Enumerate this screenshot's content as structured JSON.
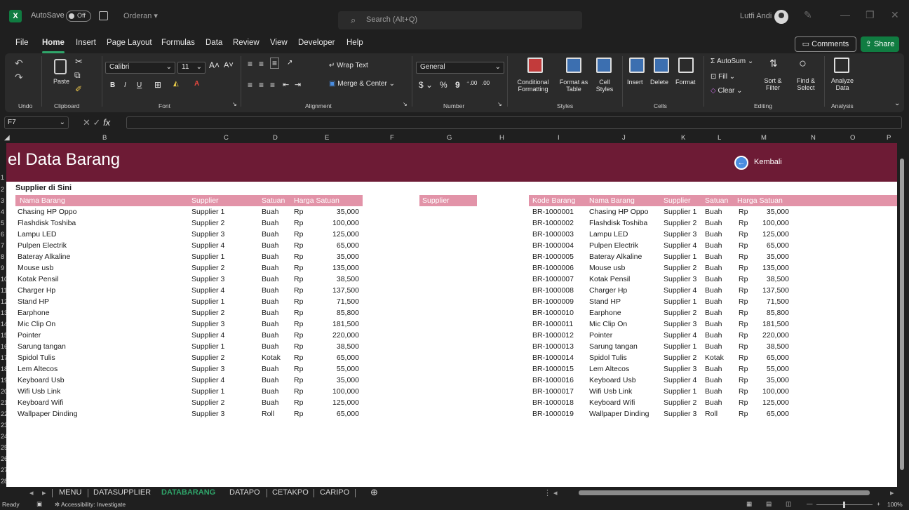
{
  "titlebar": {
    "app_icon": "X",
    "autosave_label": "AutoSave",
    "autosave_state": "Off",
    "document_name": "Orderan",
    "search_placeholder": "Search (Alt+Q)",
    "user_name": "Lutfi Andi"
  },
  "menu": {
    "tabs": [
      "File",
      "Home",
      "Insert",
      "Page Layout",
      "Formulas",
      "Data",
      "Review",
      "View",
      "Developer",
      "Help"
    ],
    "active": "Home",
    "comments_label": "Comments",
    "share_label": "Share"
  },
  "ribbon": {
    "groups": [
      "Undo",
      "Clipboard",
      "Font",
      "Alignment",
      "Number",
      "Styles",
      "Cells",
      "Editing",
      "Analysis"
    ],
    "paste_label": "Paste",
    "font_name": "Calibri",
    "font_size": "11",
    "wrap_text_label": "Wrap Text",
    "merge_center_label": "Merge & Center",
    "number_format": "General",
    "conditional_formatting_label": "Conditional Formatting",
    "format_as_table_label": "Format as Table",
    "cell_styles_label": "Cell Styles",
    "insert_label": "Insert",
    "delete_label": "Delete",
    "format_label": "Format",
    "autosum_label": "AutoSum",
    "fill_label": "Fill",
    "clear_label": "Clear",
    "sort_filter_label": "Sort & Filter",
    "find_select_label": "Find & Select",
    "analyze_data_label": "Analyze Data"
  },
  "formula_bar": {
    "name_box": "F7",
    "formula": ""
  },
  "columns": [
    "B",
    "C",
    "D",
    "E",
    "F",
    "G",
    "H",
    "I",
    "J",
    "K",
    "L",
    "M",
    "N",
    "O",
    "P"
  ],
  "rows": [
    "1",
    "2",
    "3",
    "4",
    "5",
    "6",
    "7",
    "8",
    "9",
    "10",
    "11",
    "12",
    "13",
    "14",
    "15",
    "16",
    "17",
    "18",
    "19",
    "20",
    "21",
    "22",
    "23",
    "24",
    "25",
    "26",
    "27",
    "28"
  ],
  "sheet": {
    "banner_title": "el Data Barang",
    "kembali_label": "Kembali",
    "supplier_prompt": "Supplier di Sini",
    "left_headers": [
      "Nama Barang",
      "Supplier",
      "Satuan",
      "Harga Satuan"
    ],
    "filter_header": "Supplier",
    "right_headers": [
      "Kode Barang",
      "Nama Barang",
      "Supplier",
      "Satuan",
      "Harga Satuan"
    ],
    "items": [
      {
        "kode": "BR-1000001",
        "nama": "Chasing HP Oppo",
        "supplier": "Supplier 1",
        "satuan": "Buah",
        "rp": "Rp",
        "harga": "35,000"
      },
      {
        "kode": "BR-1000002",
        "nama": "Flashdisk Toshiba",
        "supplier": "Supplier 2",
        "satuan": "Buah",
        "rp": "Rp",
        "harga": "100,000"
      },
      {
        "kode": "BR-1000003",
        "nama": "Lampu LED",
        "supplier": "Supplier 3",
        "satuan": "Buah",
        "rp": "Rp",
        "harga": "125,000"
      },
      {
        "kode": "BR-1000004",
        "nama": "Pulpen Electrik",
        "supplier": "Supplier 4",
        "satuan": "Buah",
        "rp": "Rp",
        "harga": "65,000"
      },
      {
        "kode": "BR-1000005",
        "nama": "Bateray Alkaline",
        "supplier": "Supplier 1",
        "satuan": "Buah",
        "rp": "Rp",
        "harga": "35,000"
      },
      {
        "kode": "BR-1000006",
        "nama": "Mouse usb",
        "supplier": "Supplier 2",
        "satuan": "Buah",
        "rp": "Rp",
        "harga": "135,000"
      },
      {
        "kode": "BR-1000007",
        "nama": "Kotak Pensil",
        "supplier": "Supplier 3",
        "satuan": "Buah",
        "rp": "Rp",
        "harga": "38,500"
      },
      {
        "kode": "BR-1000008",
        "nama": "Charger Hp",
        "supplier": "Supplier 4",
        "satuan": "Buah",
        "rp": "Rp",
        "harga": "137,500"
      },
      {
        "kode": "BR-1000009",
        "nama": "Stand HP",
        "supplier": "Supplier 1",
        "satuan": "Buah",
        "rp": "Rp",
        "harga": "71,500"
      },
      {
        "kode": "BR-1000010",
        "nama": "Earphone",
        "supplier": "Supplier 2",
        "satuan": "Buah",
        "rp": "Rp",
        "harga": "85,800"
      },
      {
        "kode": "BR-1000011",
        "nama": "Mic Clip On",
        "supplier": "Supplier 3",
        "satuan": "Buah",
        "rp": "Rp",
        "harga": "181,500"
      },
      {
        "kode": "BR-1000012",
        "nama": "Pointer",
        "supplier": "Supplier 4",
        "satuan": "Buah",
        "rp": "Rp",
        "harga": "220,000"
      },
      {
        "kode": "BR-1000013",
        "nama": "Sarung tangan",
        "supplier": "Supplier 1",
        "satuan": "Buah",
        "rp": "Rp",
        "harga": "38,500"
      },
      {
        "kode": "BR-1000014",
        "nama": "Spidol Tulis",
        "supplier": "Supplier 2",
        "satuan": "Kotak",
        "rp": "Rp",
        "harga": "65,000"
      },
      {
        "kode": "BR-1000015",
        "nama": "Lem Altecos",
        "supplier": "Supplier 3",
        "satuan": "Buah",
        "rp": "Rp",
        "harga": "55,000"
      },
      {
        "kode": "BR-1000016",
        "nama": "Keyboard Usb",
        "supplier": "Supplier 4",
        "satuan": "Buah",
        "rp": "Rp",
        "harga": "35,000"
      },
      {
        "kode": "BR-1000017",
        "nama": "Wifi Usb Link",
        "supplier": "Supplier 1",
        "satuan": "Buah",
        "rp": "Rp",
        "harga": "100,000"
      },
      {
        "kode": "BR-1000018",
        "nama": "Keyboard Wifi",
        "supplier": "Supplier 2",
        "satuan": "Buah",
        "rp": "Rp",
        "harga": "125,000"
      },
      {
        "kode": "BR-1000019",
        "nama": "Wallpaper Dinding",
        "supplier": "Supplier 3",
        "satuan": "Roll",
        "rp": "Rp",
        "harga": "65,000"
      }
    ],
    "header_color": "#e293a8",
    "banner_color": "#6d1b35"
  },
  "sheet_tabs": [
    "MENU",
    "DATASUPPLIER",
    "DATABARANG",
    "DATAPO",
    "CETAKPO",
    "CARIPO"
  ],
  "active_sheet": "DATABARANG",
  "status": {
    "ready": "Ready",
    "accessibility": "Accessibility: Investigate",
    "zoom": "100%"
  },
  "accent_color": "#107c41"
}
